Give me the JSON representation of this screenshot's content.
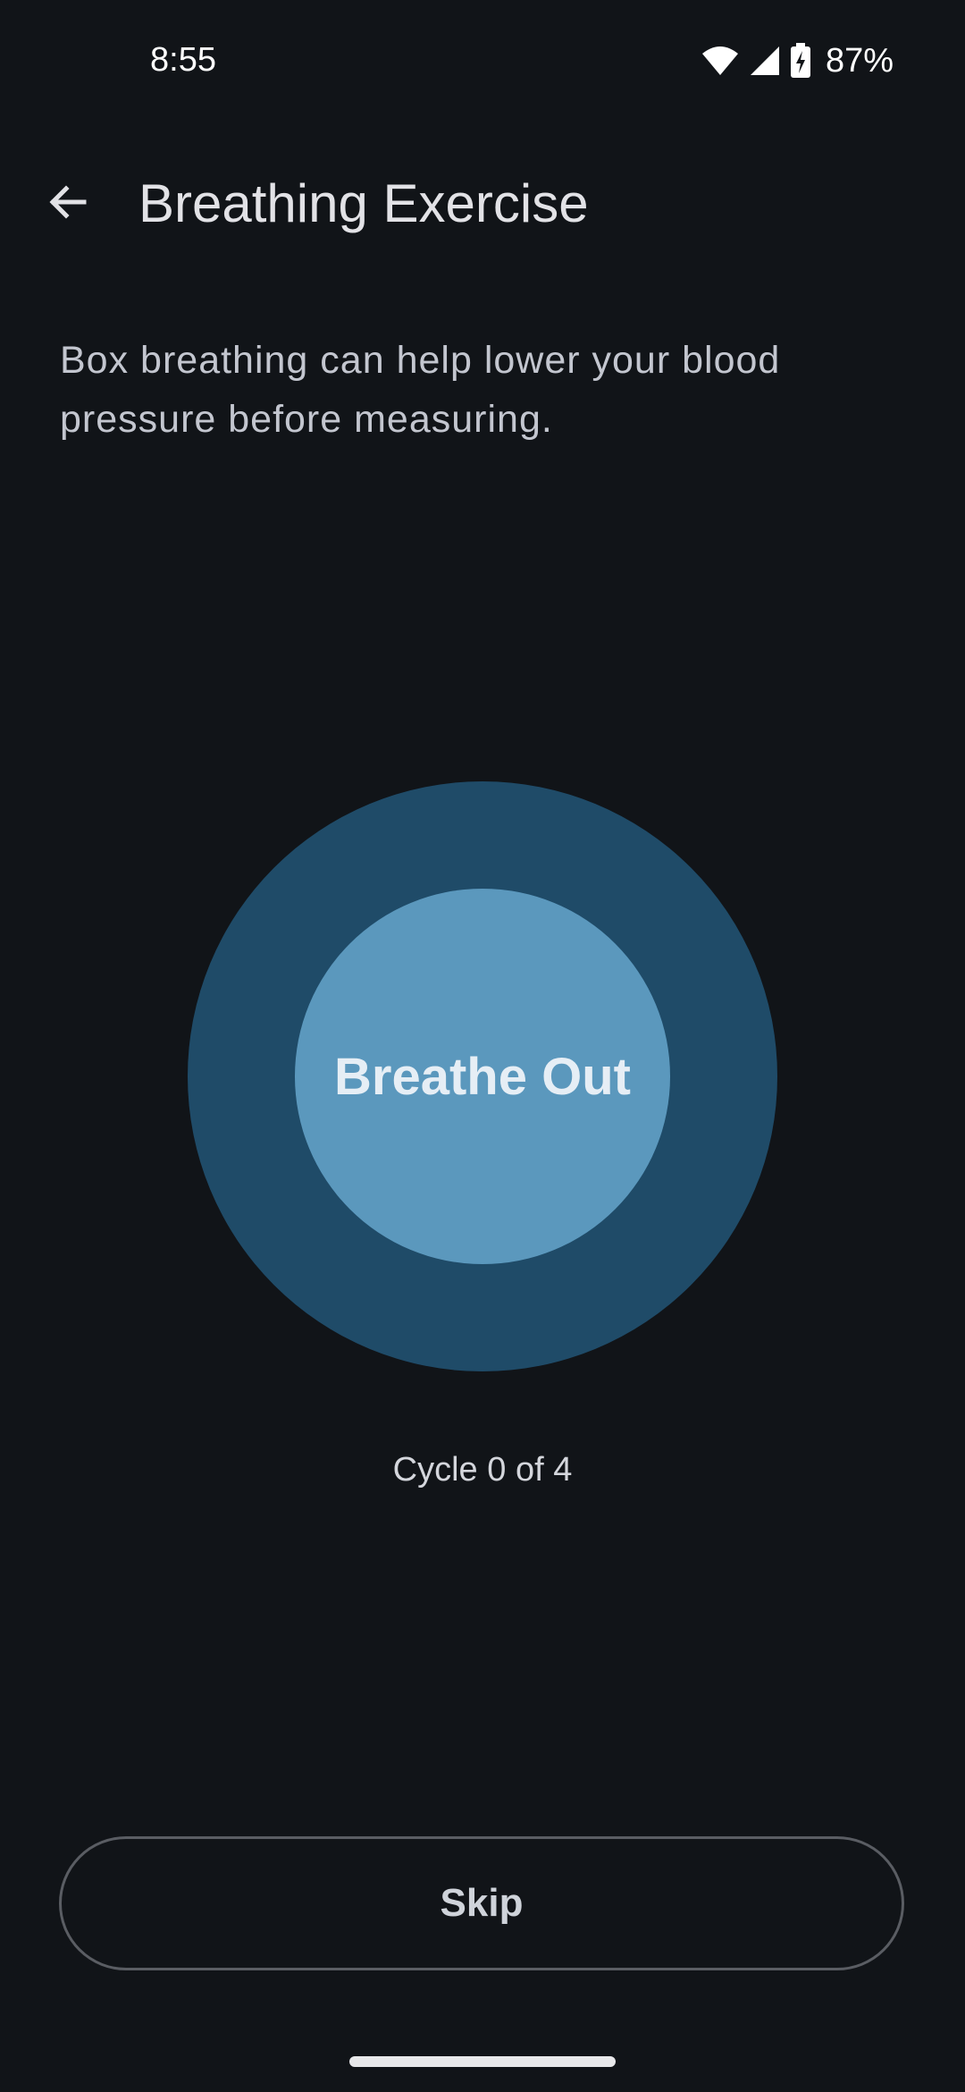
{
  "status_bar": {
    "time": "8:55",
    "battery_percent": "87%",
    "icons": [
      "wifi-icon",
      "cell-signal-icon",
      "battery-charging-icon"
    ]
  },
  "app_bar": {
    "back_icon": "arrow-back-icon",
    "title": "Breathing Exercise"
  },
  "description": "Box breathing can help lower your blood pressure before measuring.",
  "breathing": {
    "phase": "Breathe Out",
    "cycle_text": "Cycle 0 of 4",
    "outer_color": "#1f4b68",
    "inner_color": "#5b98bd"
  },
  "actions": {
    "skip_label": "Skip"
  },
  "theme": {
    "background": "#111418",
    "text_primary": "#e2e2e6",
    "text_secondary": "#c3c6cf"
  }
}
